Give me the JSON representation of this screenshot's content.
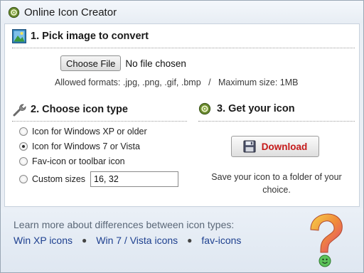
{
  "window": {
    "title": "Online Icon Creator",
    "title_icon": "ring-icon"
  },
  "step1": {
    "title": "1. Pick image to convert",
    "icon": "picture-icon",
    "choose_file_label": "Choose File",
    "file_status": "No file chosen",
    "allowed_formats": "Allowed formats: .jpg, .png, .gif, .bmp   /   Maximum size: 1MB"
  },
  "step2": {
    "title": "2. Choose icon type",
    "icon": "wrench-icon",
    "options": [
      {
        "label": "Icon for Windows XP or older",
        "checked": false
      },
      {
        "label": "Icon for Windows 7 or Vista",
        "checked": true
      },
      {
        "label": "Fav-icon or toolbar icon",
        "checked": false
      },
      {
        "label": "Custom sizes",
        "checked": false
      }
    ],
    "custom_sizes_value": "16, 32"
  },
  "step3": {
    "title": "3. Get your icon",
    "icon": "ring-icon",
    "download_label": "Download",
    "download_icon": "floppy-disk-icon",
    "save_text": "Save your icon to a folder of your choice."
  },
  "footer": {
    "learn_text": "Learn more about differences between icon types:",
    "links": [
      "Win XP icons",
      "Win 7 / Vista icons",
      "fav-icons"
    ],
    "help_icon": "question-mark-icon"
  },
  "colors": {
    "accent_link": "#1d3f8f",
    "download_text": "#c61a1a",
    "footer_bg": "#e3eaf3"
  }
}
